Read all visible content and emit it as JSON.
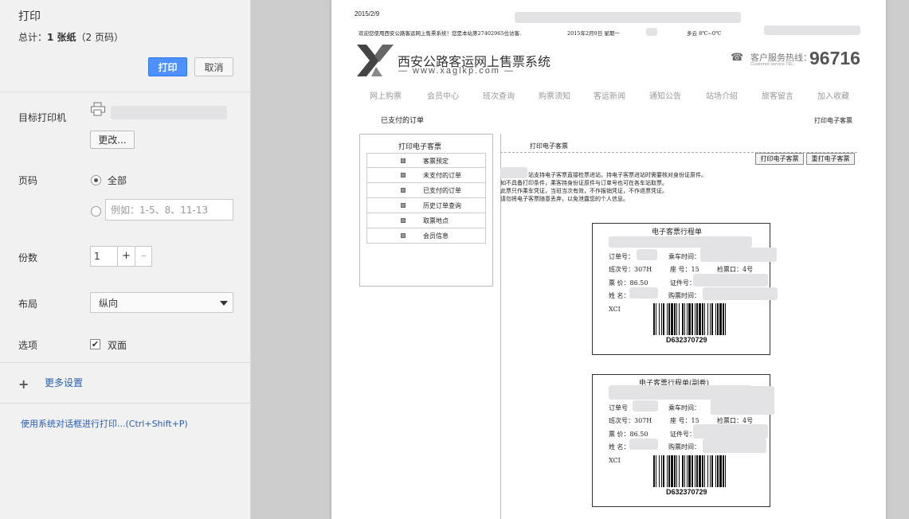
{
  "print_panel": {
    "title": "打印",
    "total_prefix": "总计：",
    "total_sheets": "1 张纸",
    "total_pages": "（2 页码）",
    "print_button": "打印",
    "cancel_button": "取消",
    "destination_label": "目标打印机",
    "change_button": "更改...",
    "pages_label": "页码",
    "pages_all": "全部",
    "pages_custom_placeholder": "例如：1-5、8、11-13",
    "copies_label": "份数",
    "copies_value": "1",
    "copies_plus": "+",
    "copies_minus": "–",
    "layout_label": "布局",
    "layout_value": "纵向",
    "options_label": "选项",
    "duplex_label": "双面",
    "duplex_checked": true,
    "more_settings": "更多设置",
    "system_dialog_link": "使用系统对话框进行打印...(Ctrl+Shift+P)"
  },
  "preview_page": {
    "date": "2015/2/9",
    "welcome": "欢迎您使用西安公路客运网上售票系统！您是本站第27402965位访客.",
    "today": "2015年2月9日 星期一",
    "weather": "多云   8℃~0℃",
    "site_name": "西安公路客运网上售票系统",
    "site_url": "— www.xaglkp.com —",
    "hotline_label": "客户服务热线：",
    "hotline_sub": "Customer service TEL:",
    "hotline_number": "96716",
    "nav": [
      "网上购票",
      "会员中心",
      "班次查询",
      "购票须知",
      "客运新闻",
      "通知公告",
      "站场介绍",
      "旅客留言",
      "加入收藏"
    ],
    "breadcrumb": "已支付的订单",
    "print_ticket_link": "打印电子客票",
    "side_menu_title": "打印电子客票",
    "side_menu": [
      "客票预定",
      "未支付的订单",
      "已支付的订单",
      "历史订单查询",
      "取票地点",
      "会员信息"
    ],
    "section_title": "打印电子客票",
    "btn_print_ticket": "打印电子客票",
    "btn_reprint_ticket": "重打电子客票",
    "notice": [
      "站支持电子客票直接检票进站，持电子客票进站时需要核对身份证原件。",
      "如不具备打印条件，乘客持身份证原件与订单号也可在各车站取票。",
      "此票只作乘车凭证，当班当次有效，不作报销凭证，不作退票凭证。",
      "请勿将电子客票随意丢弃，以免泄露您的个人信息。"
    ],
    "tickets": [
      {
        "title": "电子客票行程单",
        "order_label": "订单号：",
        "depart_label": "乘车时间：",
        "schedule": "班次号：307H",
        "seat": "座  号：15",
        "gate": "检票口：4号",
        "price": "票  价：86.50",
        "id_label": "证件号：",
        "name_label": "姓  名：",
        "buy_label": "购票时间：",
        "xci": "XCI",
        "barcode": "D632370729"
      },
      {
        "title": "电子客票行程单(副卷)",
        "order_label": "订单号",
        "depart_label": "乘车时间：",
        "schedule": "班次号：307H",
        "seat": "座  号：15",
        "gate": "检票口：4号",
        "price": "票  价：86.50",
        "id_label": "证件号：",
        "name_label": "姓  名：",
        "buy_label": "购票时间：",
        "xci": "XCI",
        "barcode": "D632370729"
      }
    ]
  },
  "colors": {
    "accent": "#4d90fe",
    "link": "#2a5db0",
    "panel_bg": "#f1f1f1",
    "preview_bg": "#cccccc"
  },
  "icons": [
    "printer-icon",
    "plus-icon",
    "chevron-down-icon",
    "phone-icon",
    "checkmark-icon"
  ]
}
